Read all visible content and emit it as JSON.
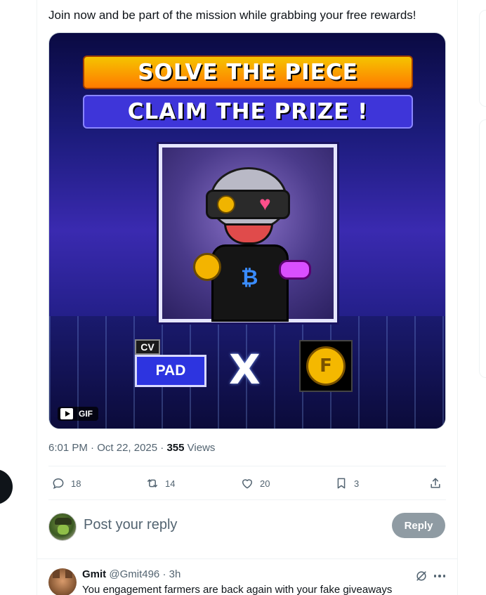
{
  "tweet": {
    "text": "Join now and be part of the mission while grabbing your free rewards!",
    "media": {
      "type": "GIF",
      "badge_label": "GIF",
      "banner_line_1": "SOLVE THE PIECE",
      "banner_line_2": "CLAIM THE PRIZE !",
      "cv_label": "CV",
      "pad_label": "PAD",
      "x_logo": "X",
      "coin_letter": "F",
      "bitcoin_symbol": "₿"
    },
    "meta": {
      "time": "6:01 PM",
      "separator": "·",
      "date": "Oct 22, 2025",
      "views_count": "355",
      "views_label": "Views"
    },
    "actions": {
      "replies": "18",
      "reposts": "14",
      "likes": "20",
      "bookmarks": "3"
    },
    "icons": {
      "reply": "reply-icon",
      "repost": "repost-icon",
      "like": "heart-icon",
      "bookmark": "bookmark-icon",
      "share": "share-icon"
    }
  },
  "composer": {
    "placeholder": "Post your reply",
    "button_label": "Reply"
  },
  "reply": {
    "name": "Gmit",
    "handle": "@Gmit496",
    "separator": "·",
    "time": "3h",
    "text": "You engagement farmers are back again with your  fake giveaways"
  },
  "colors": {
    "text_primary": "#0f1419",
    "text_secondary": "#536471",
    "border": "#eff3f4",
    "reply_button_disabled": "#8f9ba3"
  }
}
